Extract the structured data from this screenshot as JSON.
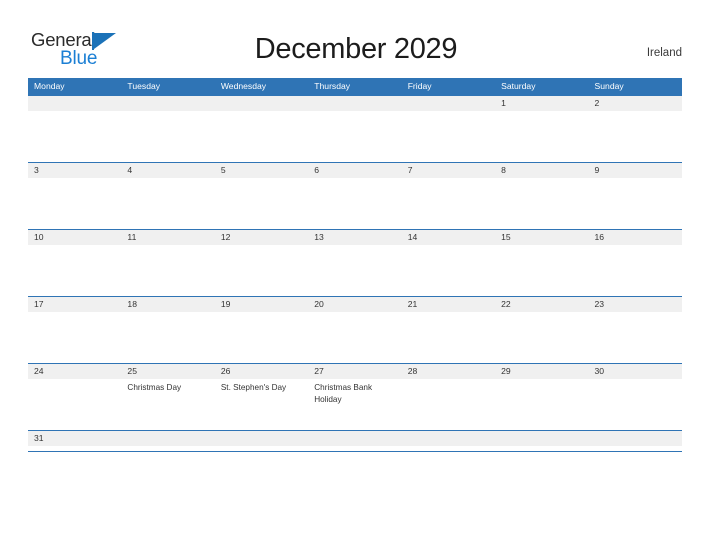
{
  "brand": {
    "name_part1": "General",
    "name_part2": "Blue",
    "icon": "sail-triangle-icon",
    "color_dark": "#2b2b2b",
    "color_blue": "#1b7fd4"
  },
  "header": {
    "title": "December 2029",
    "locale": "Ireland"
  },
  "theme": {
    "header_blue": "#2f74b5",
    "band_gray": "#f0f0f0",
    "text_dark": "#333333",
    "page_background": "#ffffff"
  },
  "calendar": {
    "month": "December",
    "year": "2029",
    "weekday_headers": [
      "Monday",
      "Tuesday",
      "Wednesday",
      "Thursday",
      "Friday",
      "Saturday",
      "Sunday"
    ],
    "weeks": [
      {
        "days": [
          {
            "date": "",
            "event": ""
          },
          {
            "date": "",
            "event": ""
          },
          {
            "date": "",
            "event": ""
          },
          {
            "date": "",
            "event": ""
          },
          {
            "date": "",
            "event": ""
          },
          {
            "date": "1",
            "event": ""
          },
          {
            "date": "2",
            "event": ""
          }
        ]
      },
      {
        "days": [
          {
            "date": "3",
            "event": ""
          },
          {
            "date": "4",
            "event": ""
          },
          {
            "date": "5",
            "event": ""
          },
          {
            "date": "6",
            "event": ""
          },
          {
            "date": "7",
            "event": ""
          },
          {
            "date": "8",
            "event": ""
          },
          {
            "date": "9",
            "event": ""
          }
        ]
      },
      {
        "days": [
          {
            "date": "10",
            "event": ""
          },
          {
            "date": "11",
            "event": ""
          },
          {
            "date": "12",
            "event": ""
          },
          {
            "date": "13",
            "event": ""
          },
          {
            "date": "14",
            "event": ""
          },
          {
            "date": "15",
            "event": ""
          },
          {
            "date": "16",
            "event": ""
          }
        ]
      },
      {
        "days": [
          {
            "date": "17",
            "event": ""
          },
          {
            "date": "18",
            "event": ""
          },
          {
            "date": "19",
            "event": ""
          },
          {
            "date": "20",
            "event": ""
          },
          {
            "date": "21",
            "event": ""
          },
          {
            "date": "22",
            "event": ""
          },
          {
            "date": "23",
            "event": ""
          }
        ]
      },
      {
        "days": [
          {
            "date": "24",
            "event": ""
          },
          {
            "date": "25",
            "event": "Christmas Day"
          },
          {
            "date": "26",
            "event": "St. Stephen's Day"
          },
          {
            "date": "27",
            "event": "Christmas Bank Holiday"
          },
          {
            "date": "28",
            "event": ""
          },
          {
            "date": "29",
            "event": ""
          },
          {
            "date": "30",
            "event": ""
          }
        ]
      },
      {
        "days": [
          {
            "date": "31",
            "event": ""
          },
          {
            "date": "",
            "event": ""
          },
          {
            "date": "",
            "event": ""
          },
          {
            "date": "",
            "event": ""
          },
          {
            "date": "",
            "event": ""
          },
          {
            "date": "",
            "event": ""
          },
          {
            "date": "",
            "event": ""
          }
        ]
      }
    ]
  }
}
